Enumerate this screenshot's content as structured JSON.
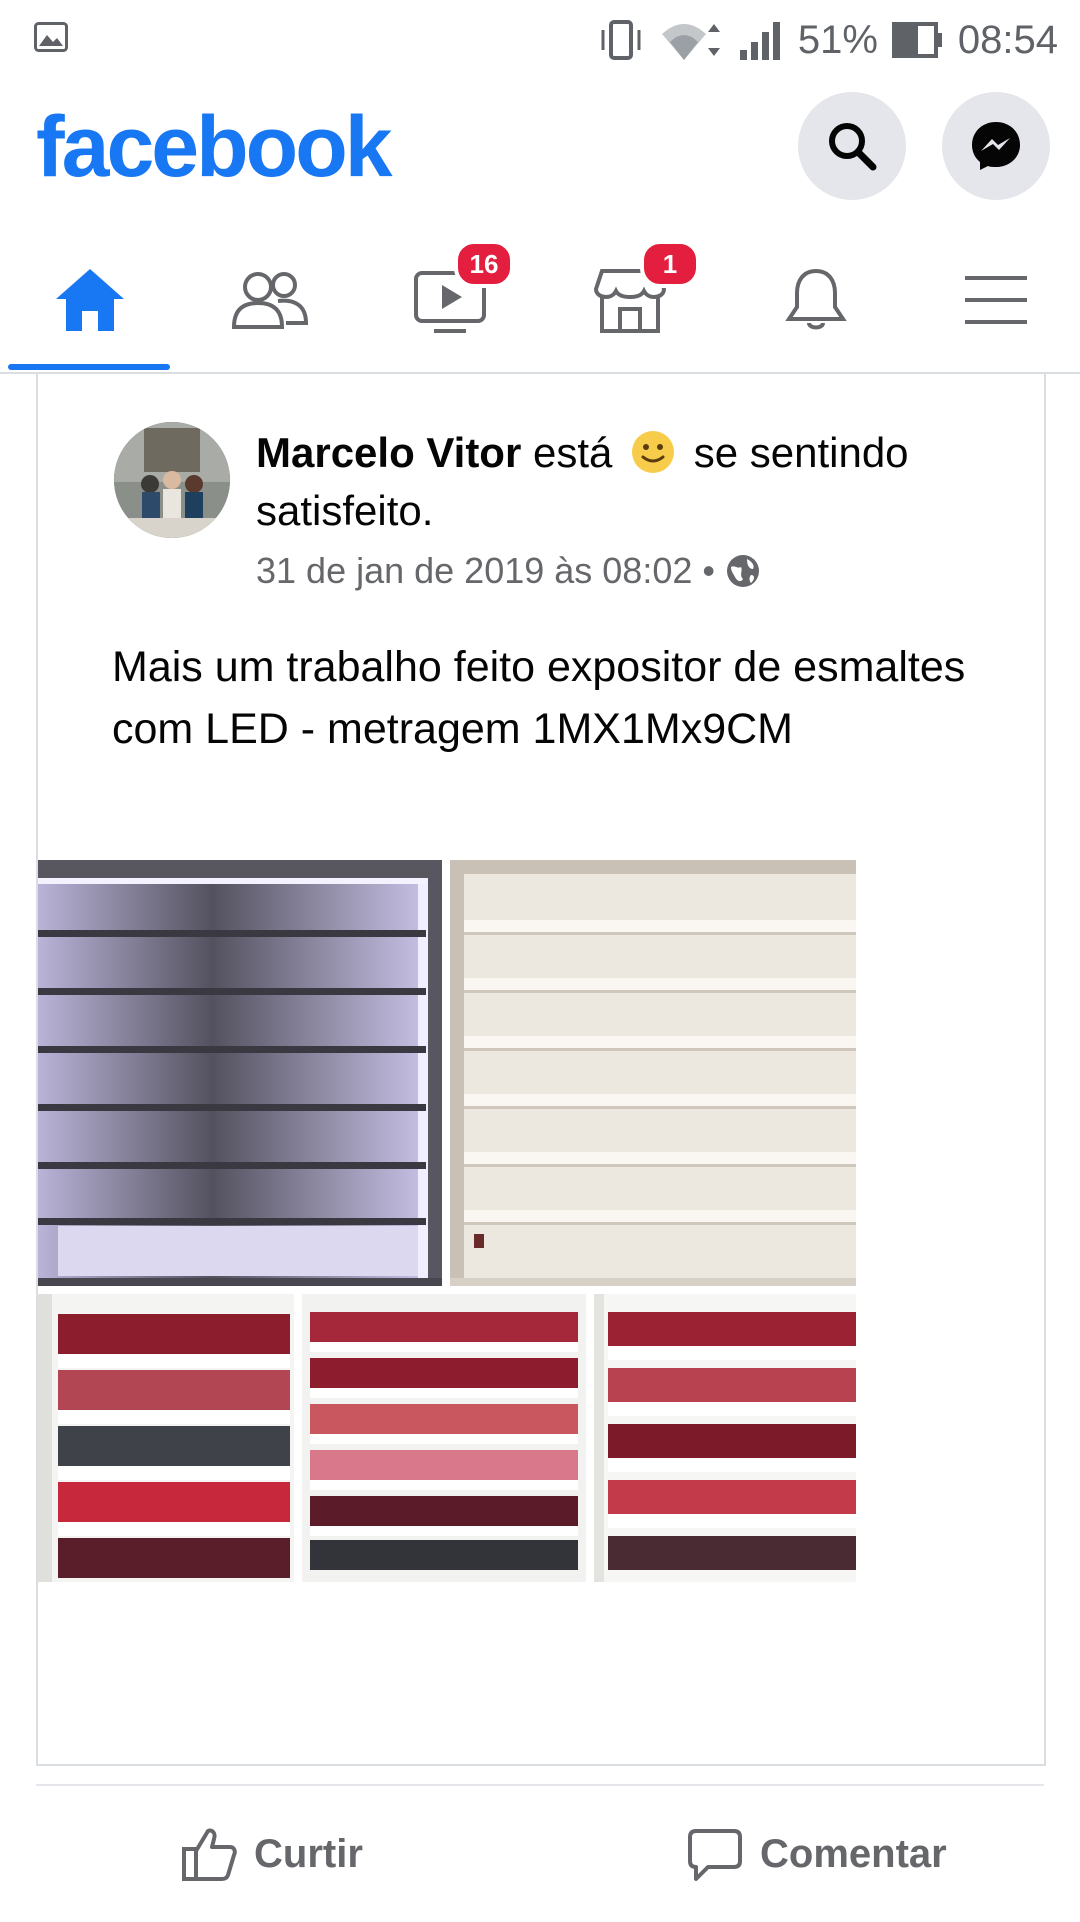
{
  "status_bar": {
    "battery": "51%",
    "time": "08:54"
  },
  "header": {
    "logo": "facebook",
    "brand_color": "#1877f2"
  },
  "tabs": [
    {
      "name": "home",
      "icon": "home-icon",
      "active": true
    },
    {
      "name": "friends",
      "icon": "friends-icon"
    },
    {
      "name": "watch",
      "icon": "watch-icon",
      "badge": "16"
    },
    {
      "name": "marketplace",
      "icon": "marketplace-icon",
      "badge": "1"
    },
    {
      "name": "notifications",
      "icon": "bell-icon"
    },
    {
      "name": "menu",
      "icon": "menu-icon"
    }
  ],
  "post": {
    "author": "Marcelo Vitor",
    "feeling_prefix": "está",
    "feeling_suffix": "se sentindo satisfeito.",
    "timestamp": "31 de jan de 2019 às 08:02",
    "separator": "•",
    "privacy_icon": "globe-icon",
    "text": "Mais um trabalho feito expositor de esmaltes com LED - metragem 1MX1Mx9CM"
  },
  "actions": {
    "like": "Curtir",
    "comment": "Comentar"
  }
}
